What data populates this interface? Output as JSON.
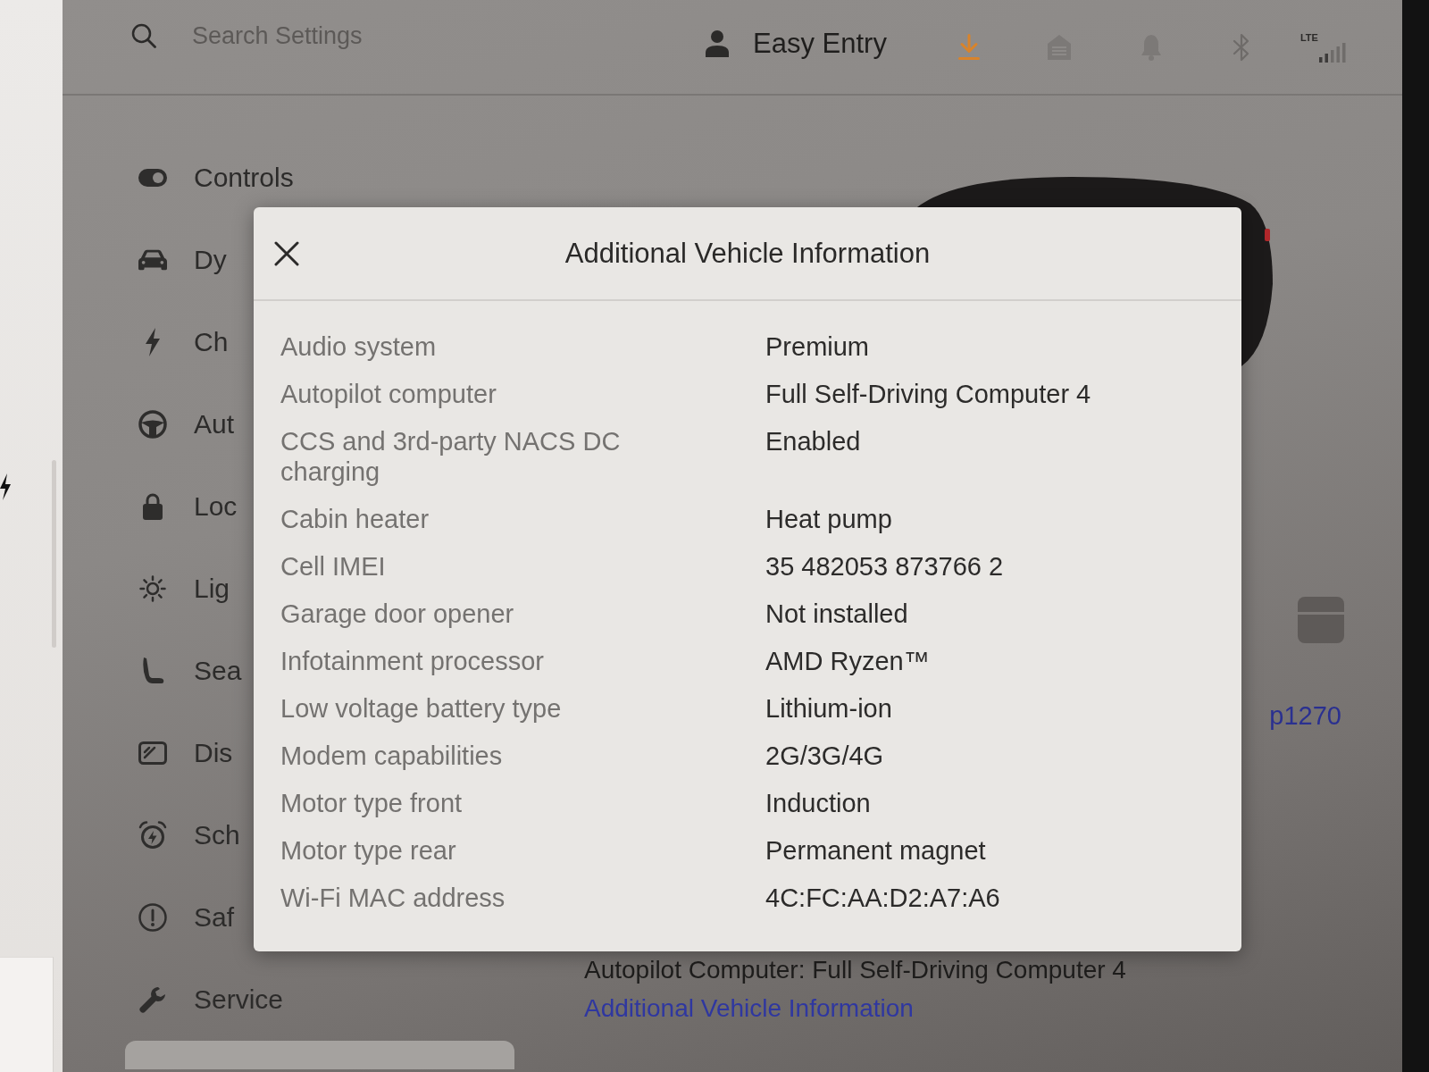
{
  "top_bar": {
    "search": {
      "placeholder": "Search Settings"
    },
    "profile": {
      "name": "Easy Entry"
    },
    "network": {
      "label": "LTE"
    }
  },
  "sidebar": {
    "items": [
      {
        "label": "Controls",
        "selected": false
      },
      {
        "label": "Dy",
        "selected": false
      },
      {
        "label": "Ch",
        "selected": false
      },
      {
        "label": "Aut",
        "selected": false
      },
      {
        "label": "Loc",
        "selected": false
      },
      {
        "label": "Lig",
        "selected": false
      },
      {
        "label": "Sea",
        "selected": false
      },
      {
        "label": "Dis",
        "selected": false
      },
      {
        "label": "Sch",
        "selected": false
      },
      {
        "label": "Saf",
        "selected": false
      },
      {
        "label": "Service",
        "selected": false
      },
      {
        "selected": true
      }
    ]
  },
  "modal": {
    "title": "Additional Vehicle Information",
    "rows": [
      {
        "label": "Audio system",
        "value": "Premium"
      },
      {
        "label": "Autopilot computer",
        "value": "Full Self-Driving Computer 4"
      },
      {
        "label": "CCS and 3rd-party NACS DC charging",
        "value": "Enabled"
      },
      {
        "label": "Cabin heater",
        "value": "Heat pump"
      },
      {
        "label": "Cell IMEI",
        "value": "35 482053 873766 2"
      },
      {
        "label": "Garage door opener",
        "value": "Not installed"
      },
      {
        "label": "Infotainment processor",
        "value": "AMD Ryzen™"
      },
      {
        "label": "Low voltage battery type",
        "value": "Lithium-ion"
      },
      {
        "label": "Modem capabilities",
        "value": "2G/3G/4G"
      },
      {
        "label": "Motor type front",
        "value": "Induction"
      },
      {
        "label": "Motor type rear",
        "value": "Permanent magnet"
      },
      {
        "label": "Wi-Fi MAC address",
        "value": "4C:FC:AA:D2:A7:A6"
      }
    ]
  },
  "vehicle_panel": {
    "side_link": "p1270",
    "autopilot_line": "Autopilot Computer: Full Self-Driving Computer 4",
    "info_link": "Additional Vehicle Information"
  }
}
